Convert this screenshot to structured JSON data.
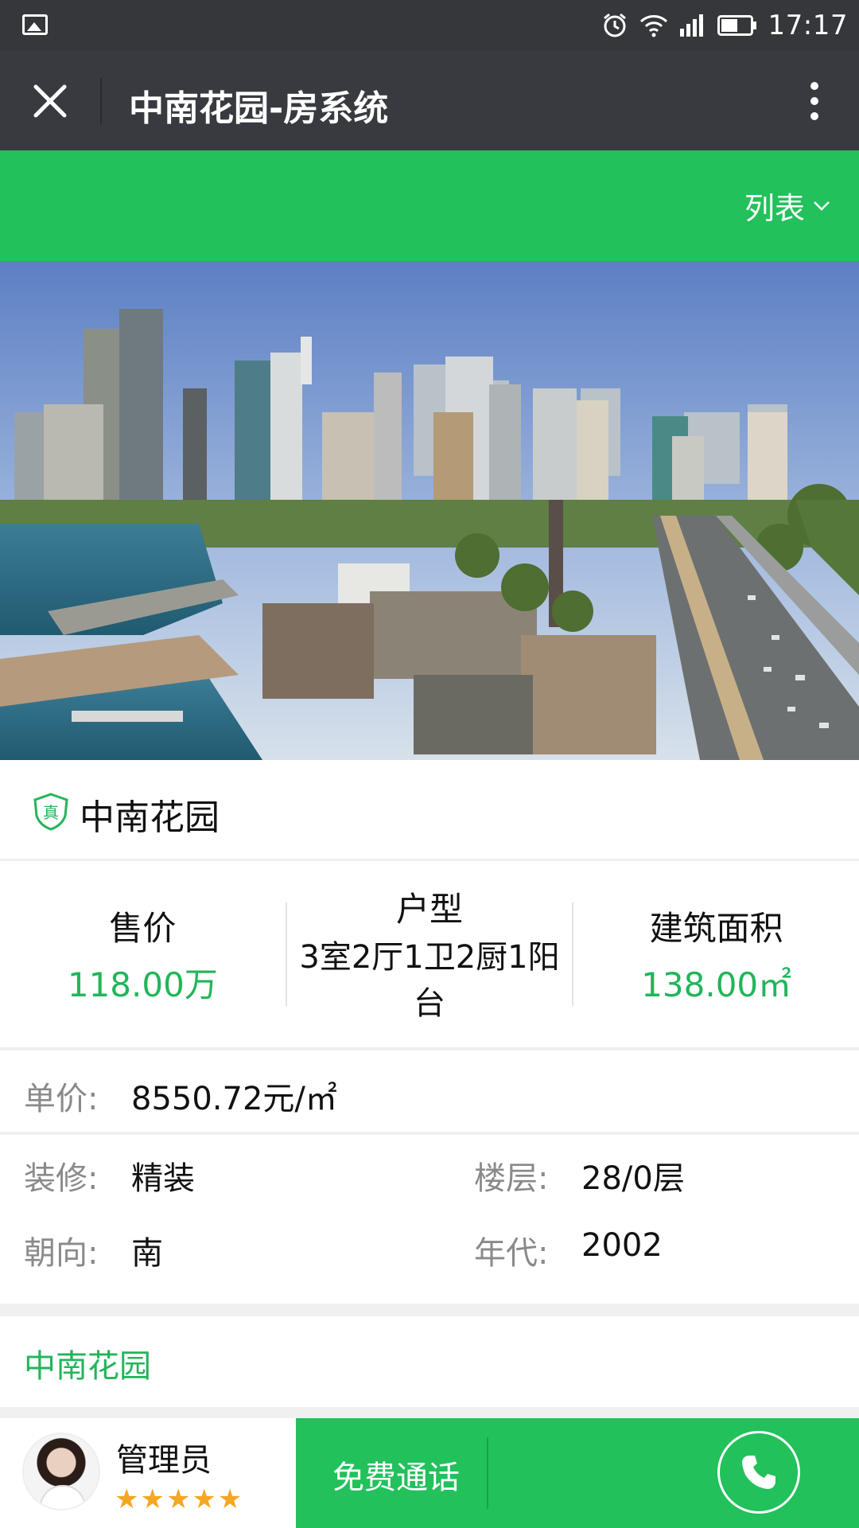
{
  "status_bar": {
    "time": "17:17",
    "icons": [
      "image-icon",
      "alarm-icon",
      "wifi-icon",
      "signal-icon",
      "battery-icon"
    ]
  },
  "header": {
    "title": "中南花园-房系统"
  },
  "filter_bar": {
    "list_label": "列表"
  },
  "listing": {
    "name": "中南花园",
    "price_label": "售价",
    "price_value": "118.00万",
    "layout_label": "户型",
    "layout_value": "3室2厅1卫2厨1阳台",
    "area_label": "建筑面积",
    "area_value": "138.00㎡",
    "unit_price_label": "单价:",
    "unit_price_value": "8550.72元/㎡",
    "decoration_label": "装修:",
    "decoration_value": "精装",
    "floor_label": "楼层:",
    "floor_value": "28/0层",
    "orientation_label": "朝向:",
    "orientation_value": "南",
    "year_label": "年代:",
    "year_value": "2002",
    "estate_link": "中南花园"
  },
  "agent": {
    "name": "管理员",
    "rating": 4.5,
    "stars_text": "★★★★★"
  },
  "call": {
    "label": "免费通话"
  },
  "colors": {
    "accent_green": "#22c15b",
    "value_green": "#22b55a",
    "status_bar": "#35373a",
    "title_bar": "#393a3f"
  }
}
